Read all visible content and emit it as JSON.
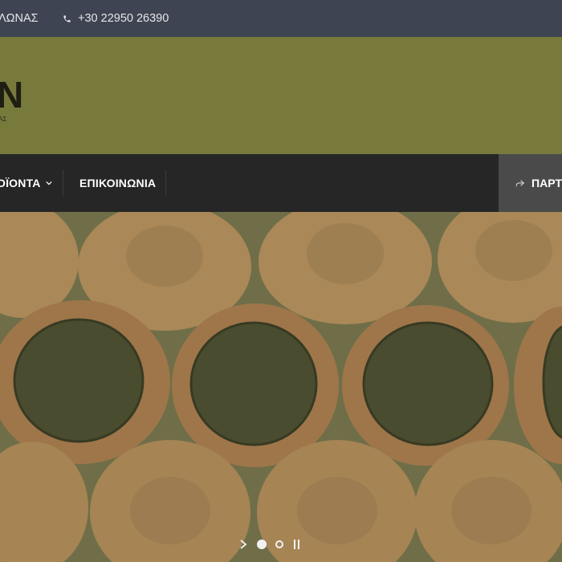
{
  "topbar": {
    "address_fragment": "ΛΩΝΑΣ",
    "phone": "+30 22950 26390",
    "phone_icon": "phone-icon"
  },
  "header": {
    "logo_fragment": "N",
    "logo_sub": "ΑΣ",
    "background": "#787a3c"
  },
  "nav": {
    "items": [
      {
        "label": "ΟΪΟΝΤΑ",
        "has_dropdown": true
      },
      {
        "label": "ΕΠΙΚΟΙΝΩΝΙΑ",
        "has_dropdown": false
      }
    ],
    "share_label": "ΠΑΡΤ",
    "share_icon": "share-arrow-icon",
    "background": "#262626"
  },
  "slider": {
    "dots": [
      {
        "active": true
      },
      {
        "active": false
      }
    ],
    "next_icon": "chevron-right-icon",
    "pause_icon": "pause-icon"
  }
}
